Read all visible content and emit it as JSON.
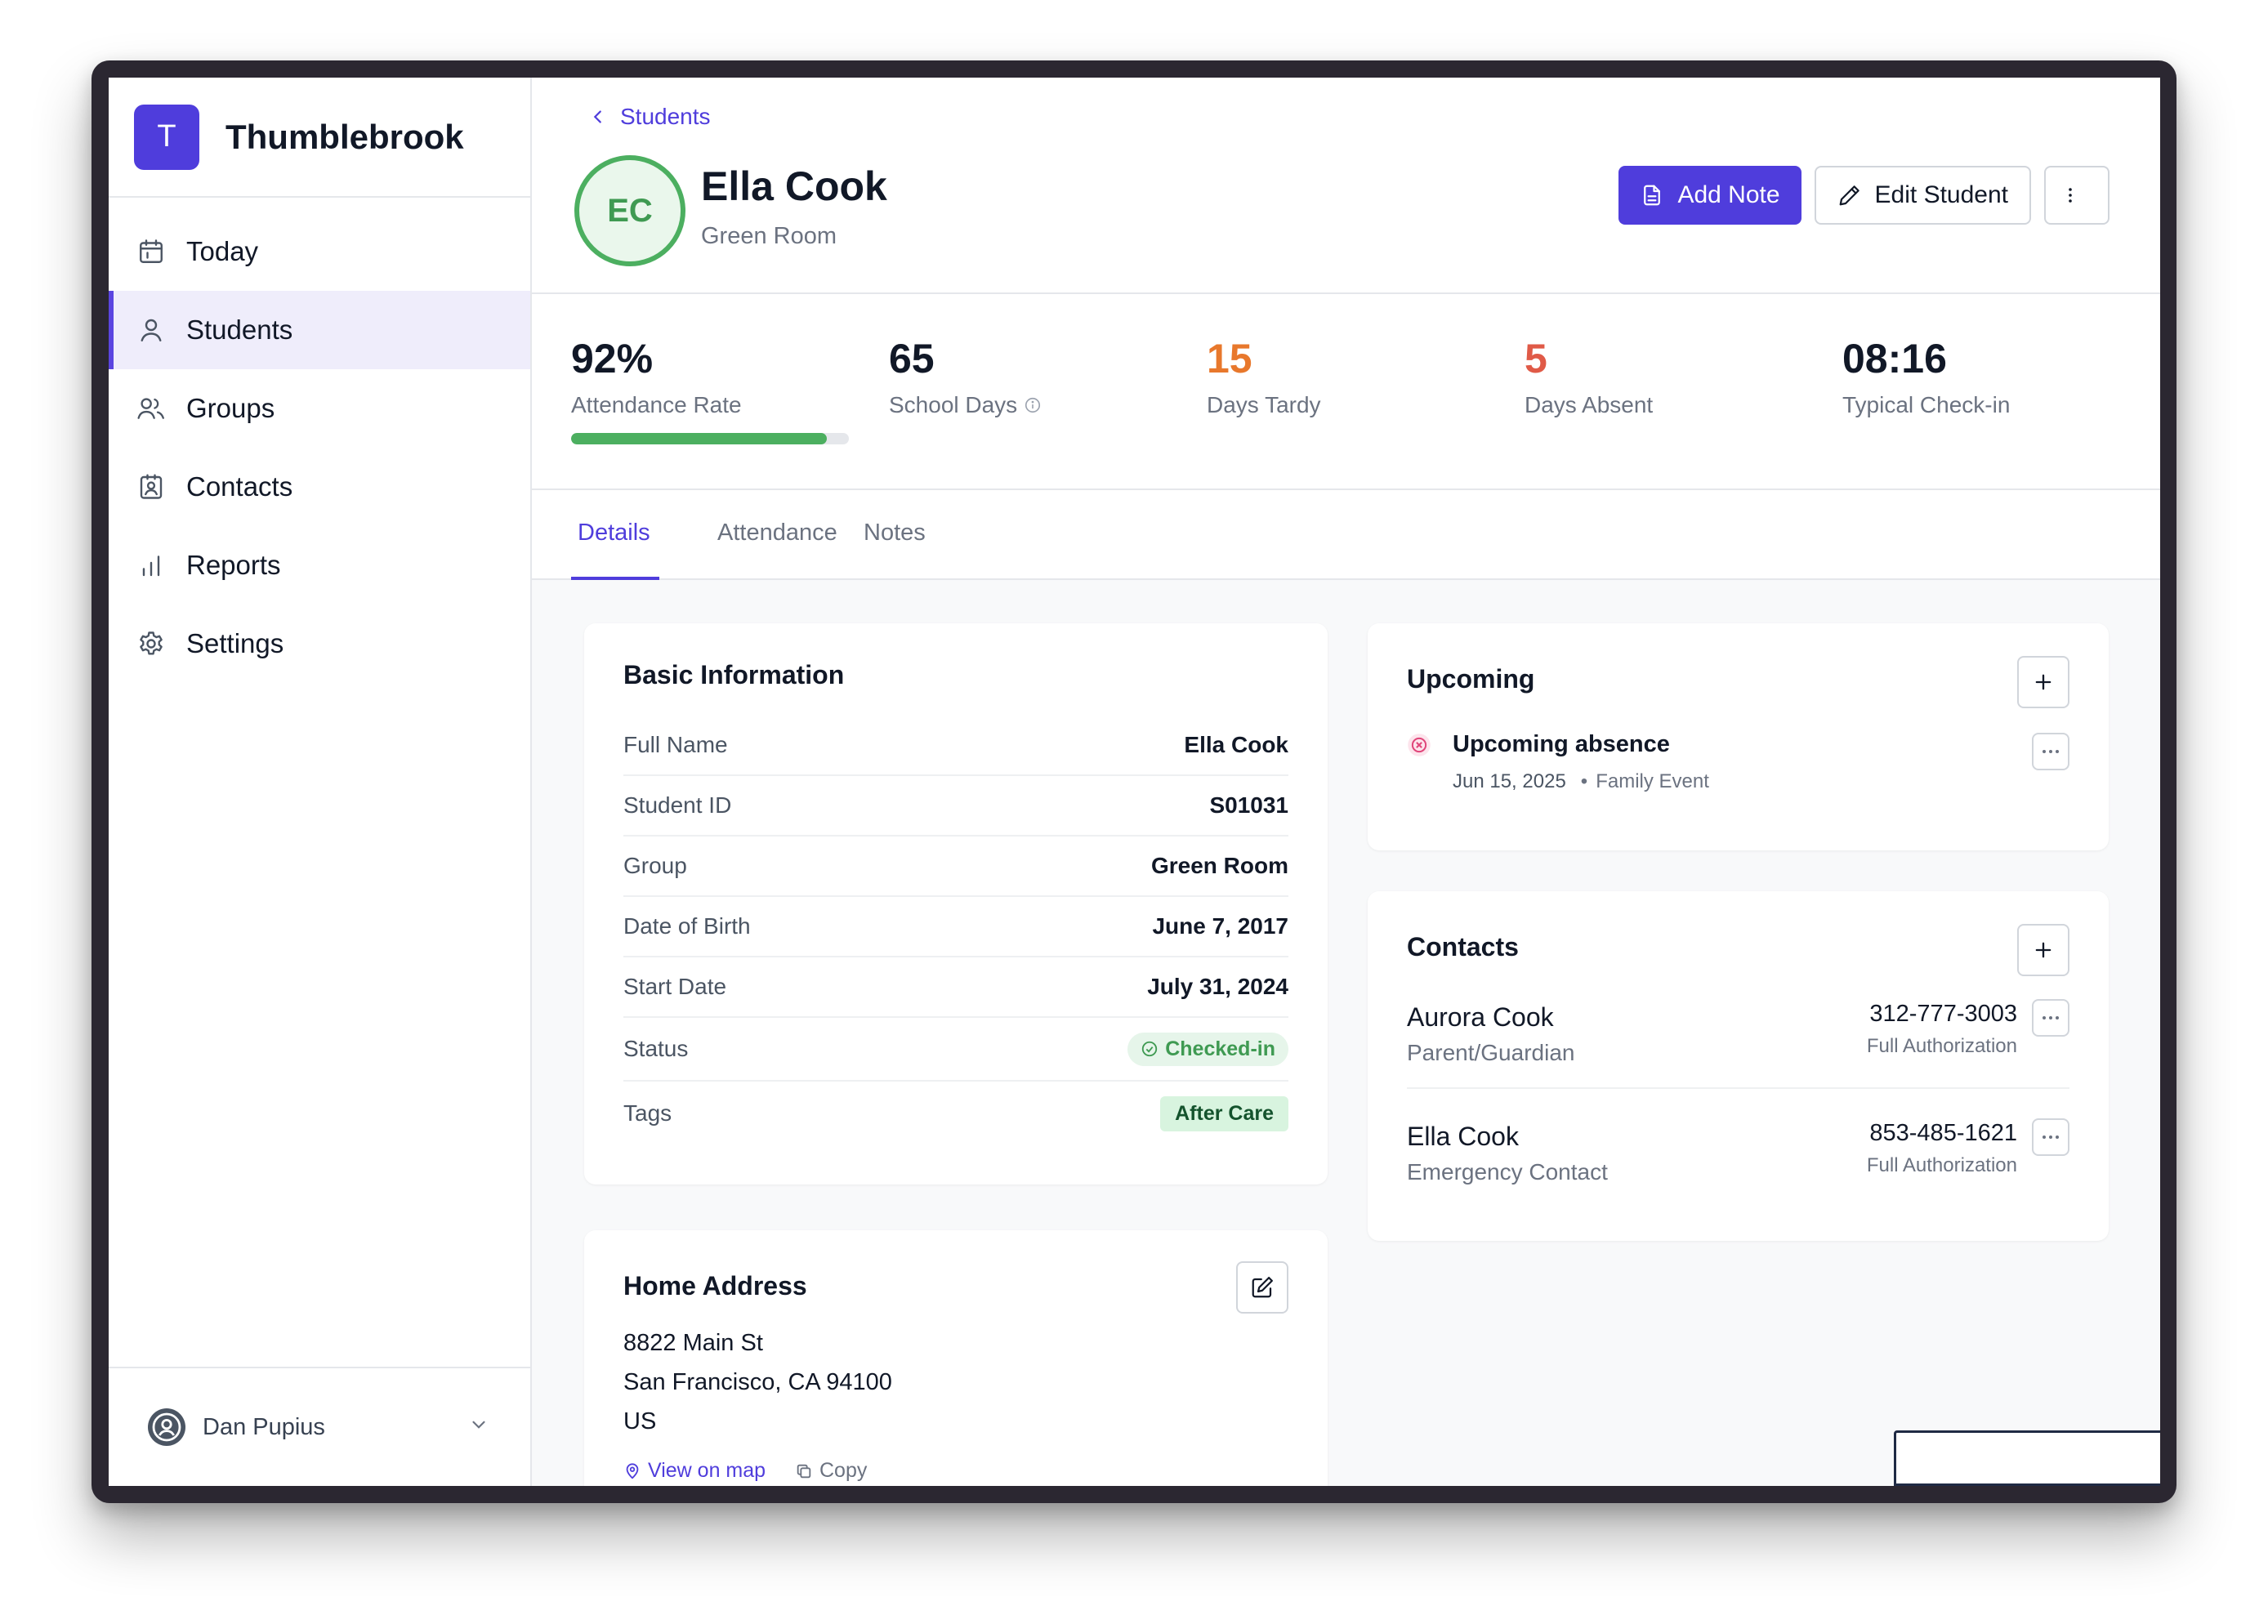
{
  "app": {
    "brand_initial": "T",
    "brand_name": "Thumblebrook"
  },
  "sidebar": {
    "items": [
      {
        "label": "Today",
        "icon": "calendar-icon"
      },
      {
        "label": "Students",
        "icon": "user-icon",
        "active": true
      },
      {
        "label": "Groups",
        "icon": "users-icon"
      },
      {
        "label": "Contacts",
        "icon": "contact-card-icon"
      },
      {
        "label": "Reports",
        "icon": "bar-chart-icon"
      },
      {
        "label": "Settings",
        "icon": "gear-icon"
      }
    ],
    "user": {
      "name": "Dan Pupius"
    }
  },
  "header": {
    "breadcrumb": "Students",
    "avatar_initials": "EC",
    "student_name": "Ella Cook",
    "room": "Green Room",
    "add_note_label": "Add Note",
    "edit_student_label": "Edit Student"
  },
  "stats": [
    {
      "value": "92%",
      "label": "Attendance Rate",
      "progress": 0.92
    },
    {
      "value": "65",
      "label": "School Days"
    },
    {
      "value": "15",
      "label": "Days Tardy"
    },
    {
      "value": "5",
      "label": "Days Absent"
    },
    {
      "value": "08:16",
      "label": "Typical Check-in"
    }
  ],
  "colors": {
    "accent": "#4f3ddc",
    "tardy": "#e8782c",
    "absent": "#e05a47",
    "success": "#4caf60"
  },
  "tabs": [
    {
      "label": "Details",
      "active": true
    },
    {
      "label": "Attendance"
    },
    {
      "label": "Notes"
    }
  ],
  "basic_info": {
    "title": "Basic Information",
    "rows": [
      {
        "key": "Full Name",
        "value": "Ella Cook"
      },
      {
        "key": "Student ID",
        "value": "S01031"
      },
      {
        "key": "Group",
        "value": "Green Room"
      },
      {
        "key": "Date of Birth",
        "value": "June 7, 2017"
      },
      {
        "key": "Start Date",
        "value": "July 31, 2024"
      },
      {
        "key": "Status",
        "value": "Checked-in"
      },
      {
        "key": "Tags",
        "value": "After Care"
      }
    ]
  },
  "home_address": {
    "title": "Home Address",
    "line1": "8822 Main St",
    "line2": "San Francisco, CA 94100",
    "line3": "US",
    "view_on_map": "View on map",
    "copy": "Copy"
  },
  "upcoming": {
    "title": "Upcoming",
    "items": [
      {
        "title": "Upcoming absence",
        "date": "Jun 15, 2025",
        "detail": "Family Event"
      }
    ]
  },
  "contacts": {
    "title": "Contacts",
    "items": [
      {
        "name": "Aurora Cook",
        "role": "Parent/Guardian",
        "phone": "312-777-3003",
        "authorization": "Full Authorization"
      },
      {
        "name": "Ella Cook",
        "role": "Emergency Contact",
        "phone": "853-485-1621",
        "authorization": "Full Authorization"
      }
    ]
  }
}
